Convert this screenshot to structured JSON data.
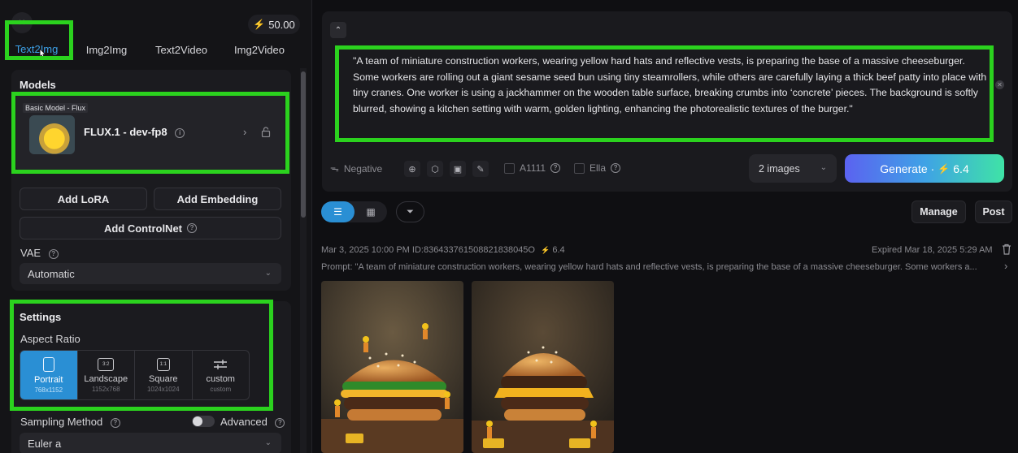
{
  "left_panel": {
    "credits": "50.00",
    "tabs": [
      "Text2Img",
      "Img2Img",
      "Text2Video",
      "Img2Video"
    ],
    "models": {
      "title": "Models",
      "tag": "Basic Model - Flux",
      "name": "FLUX.1 - dev-fp8"
    },
    "buttons": {
      "add_lora": "Add LoRA",
      "add_embedding": "Add Embedding",
      "add_controlnet": "Add ControlNet"
    },
    "vae": {
      "label": "VAE",
      "value": "Automatic"
    },
    "settings": {
      "title": "Settings",
      "aspect_ratio_label": "Aspect Ratio",
      "aspect_ratios": [
        {
          "name": "Portrait",
          "size": "768x1152",
          "icon": ""
        },
        {
          "name": "Landscape",
          "size": "1152x768",
          "icon": "3:2"
        },
        {
          "name": "Square",
          "size": "1024x1024",
          "icon": "1:1"
        },
        {
          "name": "custom",
          "size": "custom",
          "icon": ""
        }
      ]
    },
    "sampling": {
      "label": "Sampling Method",
      "advanced": "Advanced",
      "value": "Euler a"
    }
  },
  "prompt": {
    "text": "\"A team of miniature construction workers, wearing yellow hard hats and reflective vests, is preparing the base of a massive cheeseburger. Some workers are rolling out a giant sesame seed bun using tiny steamrollers, while others are carefully laying a thick beef patty into place with tiny cranes. One worker is using a jackhammer on the wooden table surface, breaking crumbs into ‘concrete’ pieces. The background is softly blurred, showing a kitchen setting with warm, golden lighting, enhancing the photorealistic textures of the burger.\"",
    "negative": "Negative",
    "a1111": "A1111",
    "ella": "Ella",
    "images_count": "2 images",
    "generate_label": "Generate",
    "generate_cost": "6.4"
  },
  "history": {
    "manage": "Manage",
    "post": "Post",
    "meta_left": "Mar 3, 2025 10:00 PM ID:836433761508821838045O",
    "cost": "6.4",
    "expired": "Expired Mar 18, 2025 5:29 AM",
    "prompt_preview": "Prompt: \"A team of miniature construction workers, wearing yellow hard hats and reflective vests, is preparing the base of a massive cheeseburger. Some workers a..."
  },
  "colors": {
    "accent": "#2a8fd4",
    "highlight": "#2bd21e"
  }
}
